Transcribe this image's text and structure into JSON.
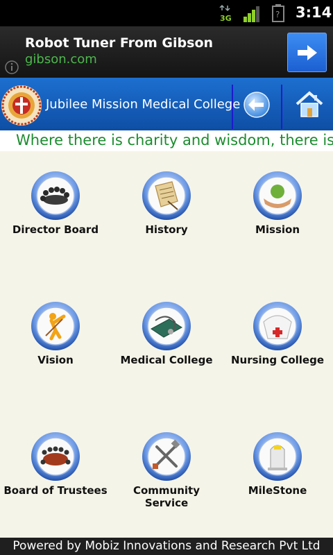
{
  "status_bar": {
    "time": "3:14",
    "network_label": "3G"
  },
  "ad": {
    "title": "Robot Tuner From Gibson",
    "url": "gibson.com"
  },
  "header": {
    "title": "Jubilee Mission Medical College"
  },
  "marquee": {
    "text": "Where there is charity and wisdom, there is neither fear nor ignorance"
  },
  "tiles": [
    {
      "label": "Director Board",
      "icon": "director-board-icon"
    },
    {
      "label": "History",
      "icon": "history-scroll-icon"
    },
    {
      "label": "Mission",
      "icon": "mission-hands-icon"
    },
    {
      "label": "Vision",
      "icon": "vision-figure-icon"
    },
    {
      "label": "Medical College",
      "icon": "medical-college-icon"
    },
    {
      "label": "Nursing College",
      "icon": "nursing-cap-icon"
    },
    {
      "label": "Board of Trustees",
      "icon": "board-table-icon"
    },
    {
      "label": "Community Service",
      "icon": "community-tools-icon"
    },
    {
      "label": "MileStone",
      "icon": "milestone-icon"
    }
  ],
  "footer": {
    "text": "Powered by Mobiz Innovations and Research Pvt Ltd"
  },
  "colors": {
    "header_blue": "#1d6fd0",
    "marquee_green": "#1b8c2e",
    "background": "#f5f4e8"
  }
}
